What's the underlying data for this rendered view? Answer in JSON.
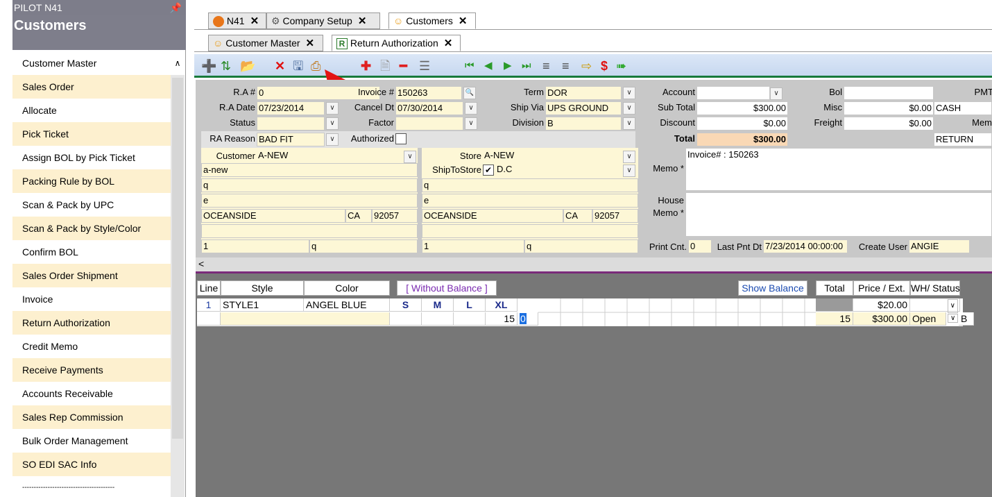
{
  "panel": {
    "pilot": "PILOT N41",
    "pin_icon": "pin-icon",
    "title": "Customers"
  },
  "menu": [
    "Customer Master",
    "Sales Order",
    "Allocate",
    "Pick Ticket",
    "Assign BOL by Pick Ticket",
    "Packing Rule by BOL",
    "Scan & Pack by UPC",
    "Scan & Pack by Style/Color",
    "Confirm BOL",
    "Sales Order Shipment",
    "Invoice",
    "Return Authorization",
    "Credit Memo",
    "Receive Payments",
    "Accounts Receivable",
    "Sales Rep Commission",
    "Bulk Order Management",
    "SO EDI SAC Info",
    "----------------------------------------"
  ],
  "tabs_top": [
    "N41",
    "Company Setup",
    "Customers"
  ],
  "tabs_sub": [
    "Customer Master",
    "Return Authorization"
  ],
  "colors": {
    "accent_green": "#177a3a",
    "menu_alt": "#fdf0cf",
    "arrow": "#e31414",
    "total_bg": "#f9d8b5"
  },
  "form": {
    "ra_label": "R.A #",
    "ra_value": "0",
    "invoice_label": "Invoice #",
    "invoice_value": "150263",
    "term_label": "Term",
    "term_value": "DOR",
    "radate_label": "R.A Date",
    "radate_value": "07/23/2014",
    "canceldt_label": "Cancel Dt",
    "canceldt_value": "07/30/2014",
    "shipvia_label": "Ship Via",
    "shipvia_value": "UPS GROUND",
    "status_label": "Status",
    "factor_label": "Factor",
    "division_label": "Division",
    "division_value": "B",
    "rareason_label": "RA Reason",
    "rareason_value": "BAD FIT",
    "authorized_label": "Authorized",
    "customer_label": "Customer",
    "customer_value": "A-NEW",
    "store_label": "Store",
    "store_value": "A-NEW",
    "shiptostore_label": "ShipToStore",
    "shiptostore_value": "D.C",
    "addr_left": [
      "a-new",
      "q",
      "e"
    ],
    "addr_right": [
      "q",
      "e"
    ],
    "city_left": "OCEANSIDE",
    "state_left": "CA",
    "zip_left": "92057",
    "city_right": "OCEANSIDE",
    "state_right": "CA",
    "zip_right": "92057",
    "phone_left": "1",
    "phone_left2": "q",
    "phone_right": "1",
    "phone_right2": "q",
    "account_label": "Account",
    "bol_label": "Bol",
    "pmt_label": "PMT",
    "subtotal_label": "Sub Total",
    "subtotal_value": "$300.00",
    "misc_label": "Misc",
    "misc_value": "$0.00",
    "misc_extra": "CASH",
    "discount_label": "Discount",
    "discount_value": "$0.00",
    "freight_label": "Freight",
    "freight_value": "$0.00",
    "mem_label": "Mem",
    "total_label": "Total",
    "total_value": "$300.00",
    "return_label": "RETURN",
    "memo_label": "Memo *",
    "memo_value": "Invoice# : 150263",
    "house_label": "House",
    "house_memo_label": "Memo *",
    "printcnt_label": "Print Cnt.",
    "printcnt_value": "0",
    "lastpnt_label": "Last Pnt Dt",
    "lastpnt_value": "7/23/2014 00:00:00",
    "createuser_label": "Create User",
    "createuser_value": "ANGIE"
  },
  "grid": {
    "headers": {
      "line": "Line",
      "style": "Style",
      "color": "Color",
      "without": "[ Without Balance ]",
      "show_balance": "Show Balance",
      "total": "Total",
      "price": "Price / Ext.",
      "wh": "WH/ Status"
    },
    "row": {
      "line": "1",
      "style": "STYLE1",
      "color": "ANGEL BLUE",
      "sizes": [
        "S",
        "M",
        "L",
        "XL"
      ],
      "qty": "15",
      "qty2": "0",
      "total": "15",
      "price": "$20.00",
      "ext": "$300.00",
      "status": "Open",
      "extra": "B"
    }
  }
}
